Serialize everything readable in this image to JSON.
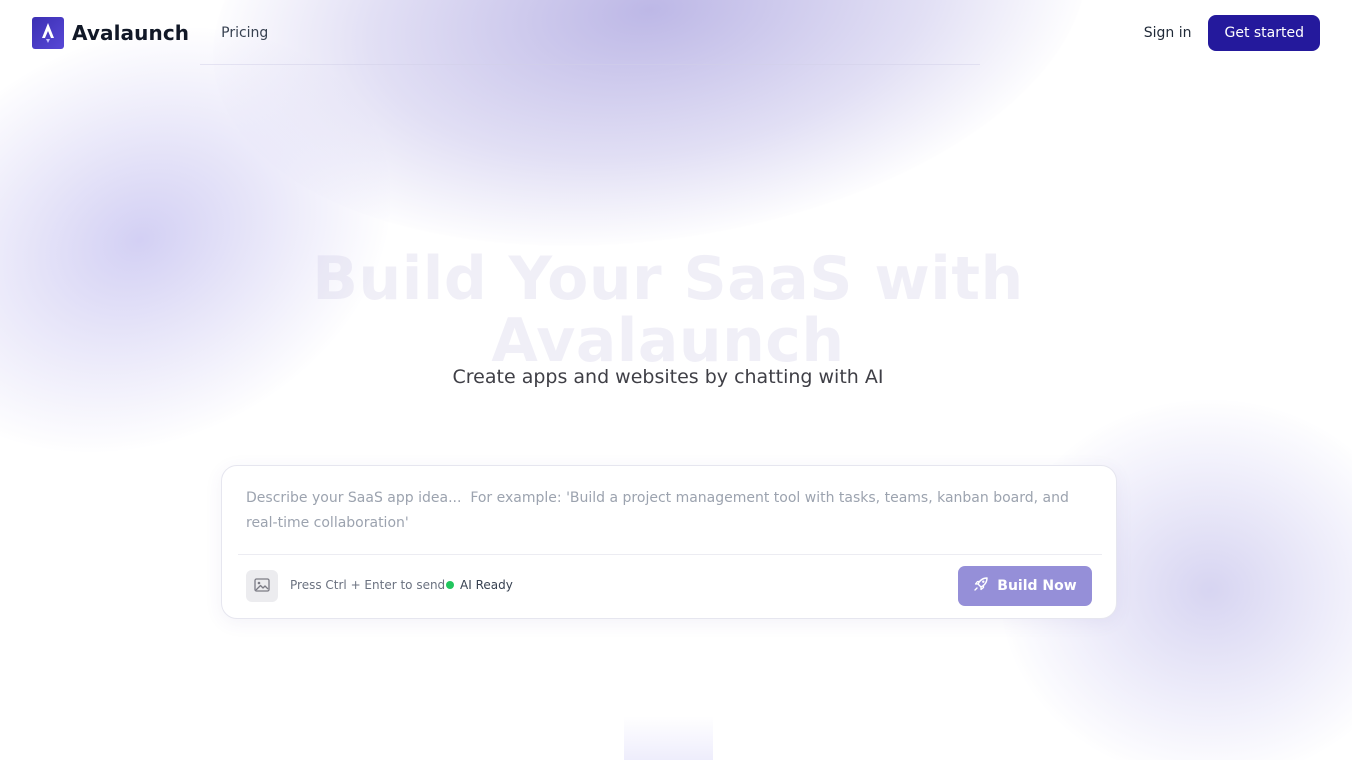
{
  "header": {
    "brand": "Avalaunch",
    "nav_pricing": "Pricing",
    "sign_in": "Sign in",
    "get_started": "Get started"
  },
  "hero": {
    "title": "Build Your SaaS with Avalaunch",
    "subtitle": "Create apps and websites by chatting with AI"
  },
  "prompt_card": {
    "placeholder": "Describe your SaaS app idea...  For example: 'Build a project management tool with tasks, teams, kanban board, and real-time collaboration'",
    "value": "",
    "hint": "Press Ctrl + Enter to send",
    "status": "AI Ready",
    "build_label": "Build Now"
  },
  "colors": {
    "brand_primary": "#24199c",
    "build_button": "#958fd8",
    "status_ok": "#22c55e"
  },
  "icons": {
    "logo": "rocket-logo-icon",
    "image_upload": "image-icon",
    "build": "rocket-icon"
  }
}
